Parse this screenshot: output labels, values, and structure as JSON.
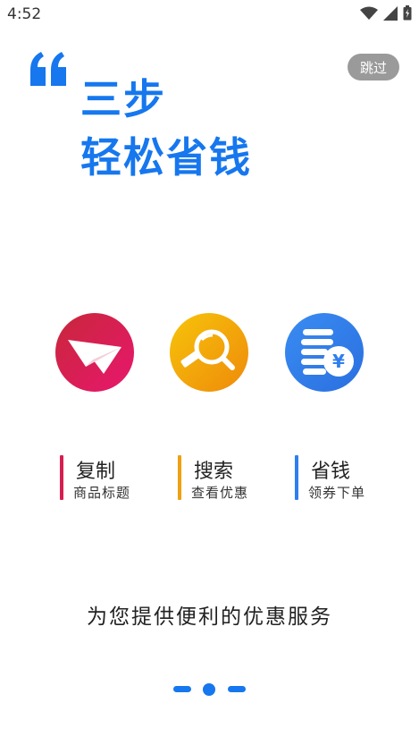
{
  "status_bar": {
    "time": "4:52"
  },
  "skip_button": {
    "label": "跳过"
  },
  "headline": {
    "line1": "三步",
    "line2": "轻松省钱"
  },
  "steps": [
    {
      "title": "复制",
      "subtitle": "商品标题",
      "color": "#d81e4f"
    },
    {
      "title": "搜索",
      "subtitle": "查看优惠",
      "color": "#f0a010"
    },
    {
      "title": "省钱",
      "subtitle": "领券下单",
      "color": "#2f7ef0"
    }
  ],
  "tagline": "为您提供便利的优惠服务",
  "pager": {
    "pages": 3,
    "current": 2
  },
  "colors": {
    "accent": "#1677ee"
  },
  "icons": [
    "paper-plane-icon",
    "magnifier-icon",
    "coins-yen-icon"
  ]
}
